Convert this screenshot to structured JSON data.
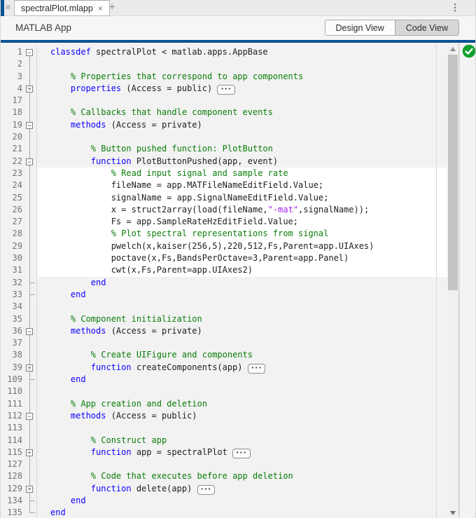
{
  "tabbar": {
    "tab_label": "spectralPlot.mlapp",
    "close_glyph": "×",
    "new_tab_glyph": "+",
    "menu_glyph": "⋮",
    "group_icon_glyph": "≡"
  },
  "header": {
    "title": "MATLAB App",
    "design_view_label": "Design View",
    "code_view_label": "Code View",
    "selected_view": "Code View"
  },
  "colors": {
    "accent_blue": "#0B5394",
    "keyword_blue": "#0E00FF",
    "comment_green": "#0A7D0A",
    "string_purple": "#A020F0",
    "analyzer_ok_green": "#12A030",
    "selected_toggle_bg": "#D7D7D7",
    "editable_region_bg": "#FFFFFF",
    "readonly_region_bg": "#F2F2F2"
  },
  "editor": {
    "analyzer_status": "ok",
    "ellipsis_glyph": "•••",
    "rows": [
      {
        "line": "1",
        "fold": "minus",
        "white": false,
        "tokens": [
          [
            "k",
            "classdef"
          ],
          [
            "p",
            " spectralPlot < matlab.apps.AppBase"
          ]
        ]
      },
      {
        "line": "2",
        "fold": "line",
        "white": false,
        "tokens": []
      },
      {
        "line": "3",
        "fold": "line",
        "white": false,
        "tokens": [
          [
            "c",
            "    % Properties that correspond to app components"
          ]
        ]
      },
      {
        "line": "4",
        "fold": "plus",
        "white": false,
        "tokens": [
          [
            "k",
            "    properties"
          ],
          [
            "p",
            " (Access = public) "
          ],
          [
            "e",
            "•••"
          ]
        ]
      },
      {
        "line": "17",
        "fold": "line",
        "white": false,
        "tokens": []
      },
      {
        "line": "18",
        "fold": "line",
        "white": false,
        "tokens": [
          [
            "c",
            "    % Callbacks that handle component events"
          ]
        ]
      },
      {
        "line": "19",
        "fold": "minus",
        "white": false,
        "tokens": [
          [
            "k",
            "    methods"
          ],
          [
            "p",
            " (Access = private)"
          ]
        ]
      },
      {
        "line": "20",
        "fold": "line",
        "white": false,
        "tokens": []
      },
      {
        "line": "21",
        "fold": "line",
        "white": false,
        "tokens": [
          [
            "c",
            "        % Button pushed function: PlotButton"
          ]
        ]
      },
      {
        "line": "22",
        "fold": "minus",
        "white": false,
        "tokens": [
          [
            "k",
            "        function"
          ],
          [
            "p",
            " PlotButtonPushed(app, event)"
          ]
        ]
      },
      {
        "line": "23",
        "fold": "line",
        "white": true,
        "tokens": [
          [
            "c",
            "            % Read input signal and sample rate"
          ]
        ]
      },
      {
        "line": "24",
        "fold": "line",
        "white": true,
        "tokens": [
          [
            "p",
            "            fileName = app.MATFileNameEditField.Value;"
          ]
        ]
      },
      {
        "line": "25",
        "fold": "line",
        "white": true,
        "tokens": [
          [
            "p",
            "            signalName = app.SignalNameEditField.Value;"
          ]
        ]
      },
      {
        "line": "26",
        "fold": "line",
        "white": true,
        "tokens": [
          [
            "p",
            "            x = struct2array(load(fileName,"
          ],
          [
            "s",
            "\"-mat\""
          ],
          [
            "p",
            ",signalName));"
          ]
        ]
      },
      {
        "line": "27",
        "fold": "line",
        "white": true,
        "tokens": [
          [
            "p",
            "            Fs = app.SampleRateHzEditField.Value;"
          ]
        ]
      },
      {
        "line": "28",
        "fold": "line",
        "white": true,
        "tokens": [
          [
            "c",
            "            % Plot spectral representations from signal"
          ]
        ]
      },
      {
        "line": "29",
        "fold": "line",
        "white": true,
        "tokens": [
          [
            "p",
            "            pwelch(x,kaiser(256,5),220,512,Fs,Parent=app.UIAxes)"
          ]
        ]
      },
      {
        "line": "30",
        "fold": "line",
        "white": true,
        "tokens": [
          [
            "p",
            "            poctave(x,Fs,BandsPerOctave=3,Parent=app.Panel)"
          ]
        ]
      },
      {
        "line": "31",
        "fold": "line",
        "white": true,
        "tokens": [
          [
            "p",
            "            cwt(x,Fs,Parent=app.UIAxes2)"
          ]
        ]
      },
      {
        "line": "32",
        "fold": "end",
        "white": false,
        "tokens": [
          [
            "k",
            "        end"
          ]
        ]
      },
      {
        "line": "33",
        "fold": "end",
        "white": false,
        "tokens": [
          [
            "k",
            "    end"
          ]
        ]
      },
      {
        "line": "34",
        "fold": "line",
        "white": false,
        "tokens": []
      },
      {
        "line": "35",
        "fold": "line",
        "white": false,
        "tokens": [
          [
            "c",
            "    % Component initialization"
          ]
        ]
      },
      {
        "line": "36",
        "fold": "minus",
        "white": false,
        "tokens": [
          [
            "k",
            "    methods"
          ],
          [
            "p",
            " (Access = private)"
          ]
        ]
      },
      {
        "line": "37",
        "fold": "line",
        "white": false,
        "tokens": []
      },
      {
        "line": "38",
        "fold": "line",
        "white": false,
        "tokens": [
          [
            "c",
            "        % Create UIFigure and components"
          ]
        ]
      },
      {
        "line": "39",
        "fold": "plus",
        "white": false,
        "tokens": [
          [
            "k",
            "        function"
          ],
          [
            "p",
            " createComponents(app) "
          ],
          [
            "e",
            "•••"
          ]
        ]
      },
      {
        "line": "109",
        "fold": "end",
        "white": false,
        "tokens": [
          [
            "k",
            "    end"
          ]
        ]
      },
      {
        "line": "110",
        "fold": "line",
        "white": false,
        "tokens": []
      },
      {
        "line": "111",
        "fold": "line",
        "white": false,
        "tokens": [
          [
            "c",
            "    % App creation and deletion"
          ]
        ]
      },
      {
        "line": "112",
        "fold": "minus",
        "white": false,
        "tokens": [
          [
            "k",
            "    methods"
          ],
          [
            "p",
            " (Access = public)"
          ]
        ]
      },
      {
        "line": "113",
        "fold": "line",
        "white": false,
        "tokens": []
      },
      {
        "line": "114",
        "fold": "line",
        "white": false,
        "tokens": [
          [
            "c",
            "        % Construct app"
          ]
        ]
      },
      {
        "line": "115",
        "fold": "plus",
        "white": false,
        "tokens": [
          [
            "k",
            "        function"
          ],
          [
            "p",
            " app = spectralPlot "
          ],
          [
            "e",
            "•••"
          ]
        ]
      },
      {
        "line": "127",
        "fold": "line",
        "white": false,
        "tokens": []
      },
      {
        "line": "128",
        "fold": "line",
        "white": false,
        "tokens": [
          [
            "c",
            "        % Code that executes before app deletion"
          ]
        ]
      },
      {
        "line": "129",
        "fold": "plus",
        "white": false,
        "tokens": [
          [
            "k",
            "        function"
          ],
          [
            "p",
            " delete(app) "
          ],
          [
            "e",
            "•••"
          ]
        ]
      },
      {
        "line": "134",
        "fold": "end",
        "white": false,
        "tokens": [
          [
            "k",
            "    end"
          ]
        ]
      },
      {
        "line": "135",
        "fold": "endlast",
        "white": false,
        "tokens": [
          [
            "k",
            "end"
          ]
        ]
      }
    ]
  }
}
